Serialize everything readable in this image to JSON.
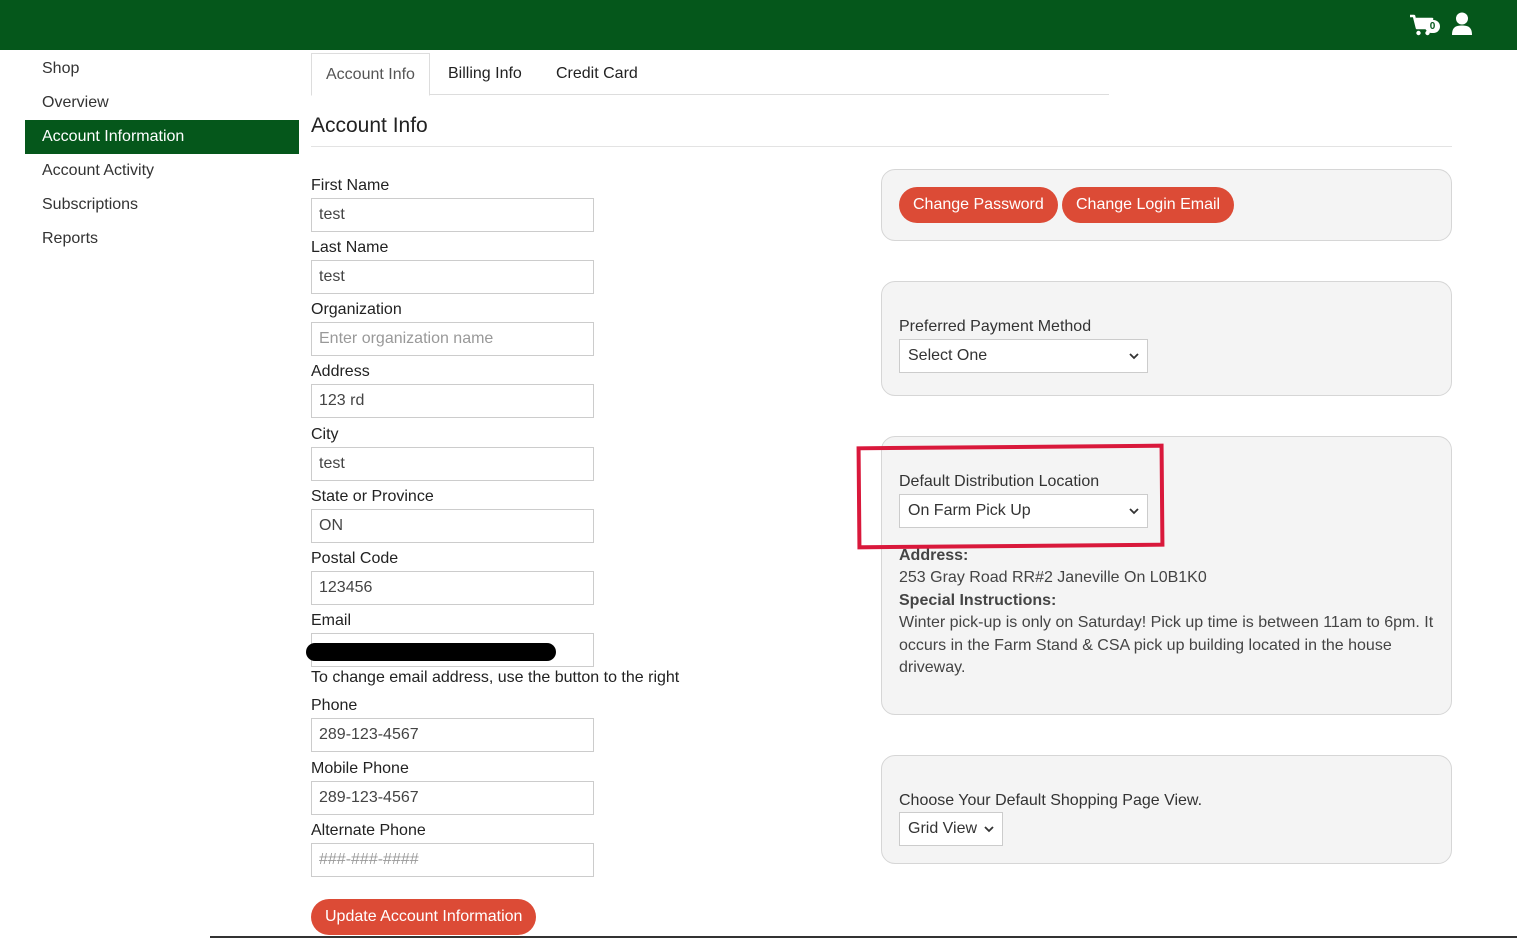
{
  "header": {
    "cart_count": "0",
    "cart_icon": "shopping-cart-icon",
    "user_icon": "user-icon",
    "brand_color": "#05571b"
  },
  "sidebar": {
    "items": [
      {
        "label": "Shop"
      },
      {
        "label": "Overview"
      },
      {
        "label": "Account Information"
      },
      {
        "label": "Account Activity"
      },
      {
        "label": "Subscriptions"
      },
      {
        "label": "Reports"
      }
    ]
  },
  "tabs": [
    {
      "label": "Account Info"
    },
    {
      "label": "Billing Info"
    },
    {
      "label": "Credit Card"
    }
  ],
  "main": {
    "title": "Account Info",
    "form": {
      "first_name": {
        "label": "First Name",
        "value": "test"
      },
      "last_name": {
        "label": "Last Name",
        "value": "test"
      },
      "organization": {
        "label": "Organization",
        "value": "",
        "placeholder": "Enter organization name"
      },
      "address": {
        "label": "Address",
        "value": "123 rd"
      },
      "city": {
        "label": "City",
        "value": "test"
      },
      "state": {
        "label": "State or Province",
        "value": "ON"
      },
      "postal": {
        "label": "Postal Code",
        "value": "123456"
      },
      "email": {
        "label": "Email",
        "value": ""
      },
      "email_help": "To change email address, use the button to the right",
      "phone": {
        "label": "Phone",
        "value": "289-123-4567"
      },
      "mobile": {
        "label": "Mobile Phone",
        "value": "289-123-4567"
      },
      "alternate": {
        "label": "Alternate Phone",
        "value": "",
        "placeholder": "###-###-####"
      },
      "submit_label": "Update Account Information"
    }
  },
  "account_panel": {
    "change_password": "Change Password",
    "change_email": "Change Login Email"
  },
  "payment_panel": {
    "label": "Preferred Payment Method",
    "selected": "Select One"
  },
  "distribution_panel": {
    "label": "Default Distribution Location",
    "selected": "On Farm Pick Up",
    "address_label": "Address:",
    "address": "253 Gray Road RR#2 Janeville On L0B1K0",
    "instructions_label": "Special Instructions:",
    "instructions": "Winter pick-up is only on Saturday! Pick up time is between 11am to 6pm. It occurs in the Farm Stand & CSA pick up building located in the house driveway."
  },
  "view_panel": {
    "label": "Choose Your Default Shopping Page View.",
    "selected": "Grid View"
  },
  "colors": {
    "button_red": "#dc4b36",
    "highlight_red": "#d9183b"
  }
}
